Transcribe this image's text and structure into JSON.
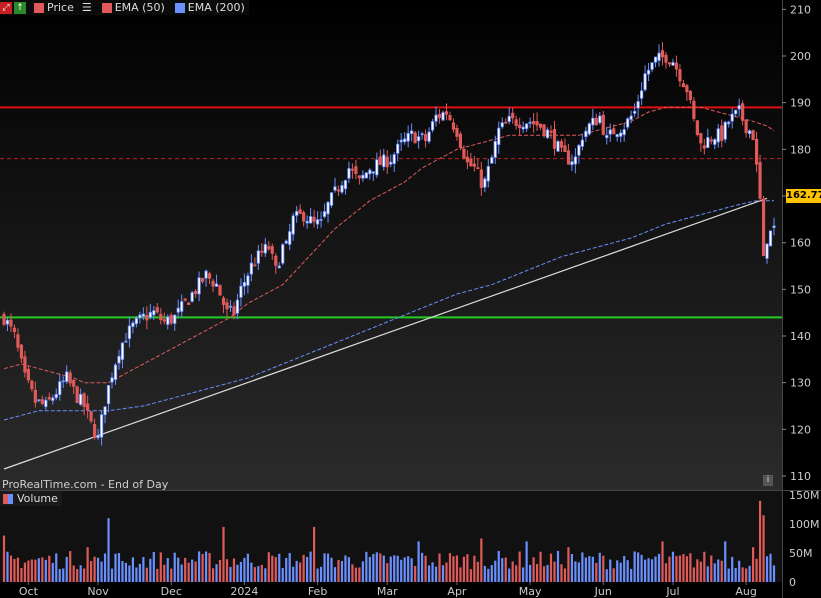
{
  "legend": {
    "price_label": "Price",
    "ema50_label": "EMA (50)",
    "ema200_label": "EMA (200)",
    "colors": {
      "ema50": "#e05a5a",
      "ema200": "#6a8fff"
    }
  },
  "watermark": "ProRealTime.com - End of Day",
  "volume_label": "Volume",
  "current_price": "162.77",
  "chart_data": [
    {
      "type": "candlestick",
      "title": "",
      "x_tick_labels": [
        "Oct",
        "Nov",
        "Dec",
        "2024",
        "Feb",
        "Mar",
        "Apr",
        "May",
        "Jun",
        "Jul",
        "Aug"
      ],
      "y_tick_labels": [
        "110",
        "120",
        "130",
        "140",
        "150",
        "160",
        "170",
        "180",
        "190",
        "200",
        "210"
      ],
      "ylim": [
        107,
        212
      ],
      "horizontal_lines": [
        {
          "value": 189,
          "color": "#e01010",
          "style": "solid"
        },
        {
          "value": 178,
          "color": "#c02020",
          "style": "dashed"
        },
        {
          "value": 144,
          "color": "#22cc22",
          "style": "solid"
        }
      ],
      "trendline": {
        "from": [
          0,
          111.5
        ],
        "to": [
          219,
          169.5
        ],
        "color": "#dddddd"
      },
      "price_path": [
        [
          0,
          144
        ],
        [
          3,
          140
        ],
        [
          6,
          131
        ],
        [
          9,
          126
        ],
        [
          12,
          125
        ],
        [
          15,
          128
        ],
        [
          18,
          131
        ],
        [
          21,
          127
        ],
        [
          23,
          125
        ],
        [
          25,
          121
        ],
        [
          27,
          118
        ],
        [
          29,
          126
        ],
        [
          31,
          132
        ],
        [
          33,
          137
        ],
        [
          35,
          140
        ],
        [
          37,
          142
        ],
        [
          40,
          144
        ],
        [
          43,
          145
        ],
        [
          46,
          143
        ],
        [
          49,
          144
        ],
        [
          52,
          147
        ],
        [
          55,
          150
        ],
        [
          58,
          153
        ],
        [
          61,
          151
        ],
        [
          64,
          145
        ],
        [
          66,
          145
        ],
        [
          68,
          150
        ],
        [
          71,
          155
        ],
        [
          74,
          158
        ],
        [
          76,
          159
        ],
        [
          78,
          154
        ],
        [
          80,
          159
        ],
        [
          81,
          159
        ],
        [
          83,
          165
        ],
        [
          86,
          166
        ],
        [
          89,
          164
        ],
        [
          91,
          164
        ],
        [
          93,
          168
        ],
        [
          96,
          172
        ],
        [
          99,
          176
        ],
        [
          102,
          173
        ],
        [
          105,
          176
        ],
        [
          108,
          177
        ],
        [
          111,
          178
        ],
        [
          114,
          181
        ],
        [
          117,
          183
        ],
        [
          121,
          182
        ],
        [
          124,
          187
        ],
        [
          127,
          188
        ],
        [
          130,
          184
        ],
        [
          133,
          177
        ],
        [
          135,
          176
        ],
        [
          137,
          173
        ],
        [
          138,
          173
        ],
        [
          140,
          178
        ],
        [
          142,
          184
        ],
        [
          145,
          186
        ],
        [
          148,
          186
        ],
        [
          151,
          186
        ],
        [
          154,
          185
        ],
        [
          157,
          183
        ],
        [
          160,
          179
        ],
        [
          162,
          178
        ],
        [
          164,
          178
        ],
        [
          166,
          183
        ],
        [
          168,
          185
        ],
        [
          171,
          187
        ],
        [
          173,
          182
        ],
        [
          175,
          184
        ],
        [
          178,
          185
        ],
        [
          181,
          188
        ],
        [
          184,
          196
        ],
        [
          187,
          199
        ],
        [
          190,
          200
        ],
        [
          192,
          199
        ],
        [
          194,
          196
        ],
        [
          196,
          193
        ],
        [
          198,
          186
        ],
        [
          200,
          181
        ],
        [
          202,
          182
        ],
        [
          204,
          183
        ],
        [
          206,
          183
        ],
        [
          208,
          186
        ],
        [
          211,
          188
        ],
        [
          213,
          185
        ],
        [
          215,
          183
        ],
        [
          217,
          169
        ],
        [
          218,
          156
        ],
        [
          219,
          161
        ],
        [
          221,
          163
        ]
      ],
      "ema50_path": [
        [
          0,
          133
        ],
        [
          5,
          134
        ],
        [
          10,
          133
        ],
        [
          15,
          132
        ],
        [
          20,
          131
        ],
        [
          23,
          130
        ],
        [
          26,
          130
        ],
        [
          30,
          130
        ],
        [
          35,
          132
        ],
        [
          40,
          134
        ],
        [
          45,
          136
        ],
        [
          50,
          138
        ],
        [
          55,
          140
        ],
        [
          60,
          142
        ],
        [
          65,
          144
        ],
        [
          70,
          147
        ],
        [
          75,
          149
        ],
        [
          80,
          151
        ],
        [
          85,
          155
        ],
        [
          90,
          159
        ],
        [
          95,
          163
        ],
        [
          100,
          166
        ],
        [
          105,
          169
        ],
        [
          110,
          171
        ],
        [
          115,
          173
        ],
        [
          120,
          176
        ],
        [
          125,
          178
        ],
        [
          130,
          180
        ],
        [
          135,
          181
        ],
        [
          140,
          182
        ],
        [
          145,
          183
        ],
        [
          150,
          183
        ],
        [
          155,
          183
        ],
        [
          160,
          183
        ],
        [
          165,
          183
        ],
        [
          170,
          184
        ],
        [
          175,
          185
        ],
        [
          180,
          186
        ],
        [
          185,
          188
        ],
        [
          190,
          189
        ],
        [
          195,
          189
        ],
        [
          200,
          189
        ],
        [
          205,
          188
        ],
        [
          210,
          187
        ],
        [
          215,
          186
        ],
        [
          219,
          185
        ],
        [
          221,
          184
        ]
      ],
      "ema200_path": [
        [
          0,
          122
        ],
        [
          10,
          124
        ],
        [
          20,
          124
        ],
        [
          30,
          124
        ],
        [
          40,
          125
        ],
        [
          50,
          127
        ],
        [
          60,
          129
        ],
        [
          70,
          131
        ],
        [
          80,
          134
        ],
        [
          90,
          137
        ],
        [
          100,
          140
        ],
        [
          110,
          143
        ],
        [
          120,
          146
        ],
        [
          130,
          149
        ],
        [
          140,
          151
        ],
        [
          150,
          154
        ],
        [
          160,
          157
        ],
        [
          170,
          159
        ],
        [
          180,
          161
        ],
        [
          190,
          164
        ],
        [
          200,
          166
        ],
        [
          210,
          168
        ],
        [
          216,
          169
        ],
        [
          221,
          169
        ]
      ],
      "volume": {
        "axis_labels": [
          "150M",
          "100M",
          "50M",
          "0"
        ],
        "ylim": [
          0,
          150
        ],
        "spikes": [
          [
            0,
            80
          ],
          [
            24,
            60
          ],
          [
            30,
            110
          ],
          [
            63,
            95
          ],
          [
            89,
            95
          ],
          [
            119,
            70
          ],
          [
            137,
            75
          ],
          [
            150,
            70
          ],
          [
            162,
            60
          ],
          [
            189,
            70
          ],
          [
            207,
            70
          ],
          [
            215,
            60
          ],
          [
            217,
            140
          ],
          [
            218,
            115
          ]
        ],
        "base_level": 40
      },
      "price_range_days": 222
    }
  ]
}
